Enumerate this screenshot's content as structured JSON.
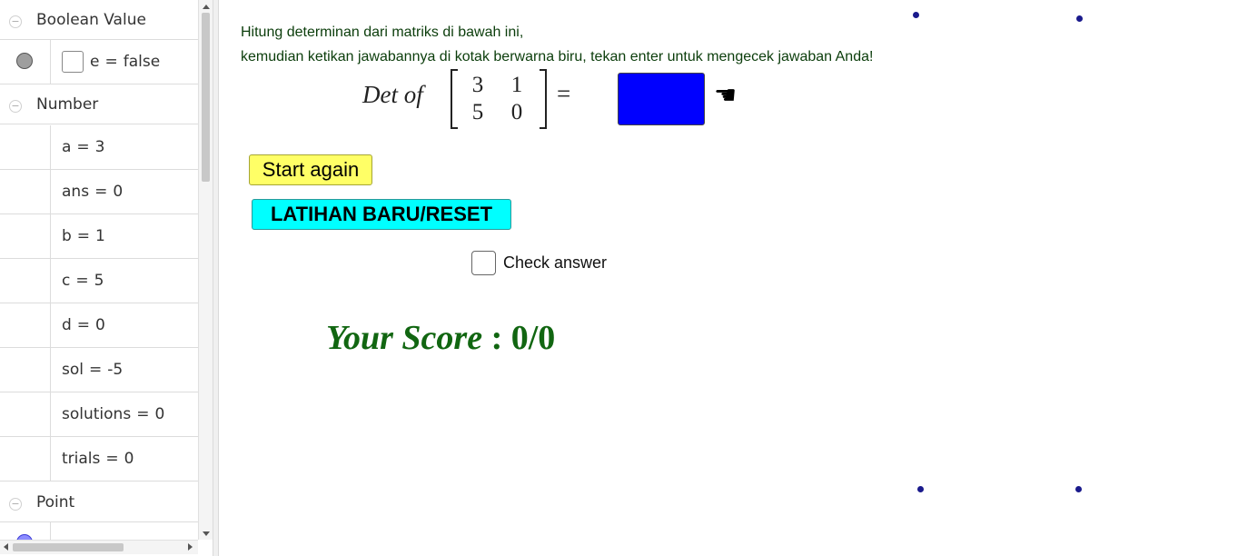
{
  "algebra": {
    "groups": {
      "boolean": {
        "label": "Boolean Value",
        "collapse_symbol": "−"
      },
      "number": {
        "label": "Number",
        "collapse_symbol": "−"
      },
      "point": {
        "label": "Point",
        "collapse_symbol": "−"
      }
    },
    "boolean_rows": [
      {
        "name": "e",
        "eq": "=",
        "value": "false"
      }
    ],
    "number_rows": [
      {
        "name": "a",
        "eq": "=",
        "value": "3"
      },
      {
        "name": "ans",
        "eq": "=",
        "value": "0"
      },
      {
        "name": "b",
        "eq": "=",
        "value": "1"
      },
      {
        "name": "c",
        "eq": "=",
        "value": "5"
      },
      {
        "name": "d",
        "eq": "=",
        "value": "0"
      },
      {
        "name": "sol",
        "eq": "=",
        "value": "-5"
      },
      {
        "name": "solutions",
        "eq": "=",
        "value": "0"
      },
      {
        "name": "trials",
        "eq": "=",
        "value": "0"
      }
    ]
  },
  "graphics": {
    "instruction_line1": "Hitung determinan dari matriks di bawah ini,",
    "instruction_line2": "kemudian ketikan jawabannya di kotak berwarna biru, tekan enter untuk mengecek jawaban Anda!",
    "det_label": "Det of",
    "matrix": [
      [
        "3",
        "1"
      ],
      [
        "5",
        "0"
      ]
    ],
    "equals": "=",
    "answer_value": "",
    "hand_glyph": "☚",
    "start_again_label": "Start again",
    "reset_label": "LATIHAN BARU/RESET",
    "check_label": "Check answer",
    "score_title": "Your Score",
    "score_sep": ":",
    "score_value": "0/0"
  },
  "colors": {
    "answer_box": "#0000ff",
    "start_button": "#ffff66",
    "reset_button": "#00ffff",
    "score_text": "#116611",
    "instruction_text": "#0b3d0b",
    "point_dots": "#1a1a8c",
    "boolean_marble": "#9e9e9e",
    "point_marble": "#8c8cff"
  },
  "icons": {
    "hand": "pointing-hand-icon",
    "collapse": "collapse-minus-icon"
  }
}
